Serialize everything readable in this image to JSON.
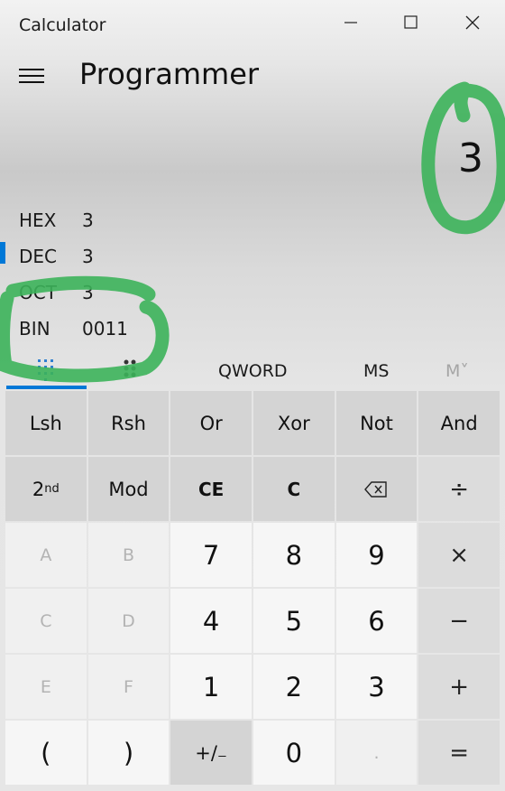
{
  "window": {
    "title": "Calculator"
  },
  "header": {
    "mode": "Programmer"
  },
  "display": {
    "value": "3"
  },
  "radix": [
    {
      "name": "HEX",
      "value": "3"
    },
    {
      "name": "DEC",
      "value": "3",
      "selected": true
    },
    {
      "name": "OCT",
      "value": "3"
    },
    {
      "name": "BIN",
      "value": "0011"
    }
  ],
  "tabs": {
    "word_size": "QWORD",
    "ms": "MS",
    "mplus": "M˅"
  },
  "keys": {
    "lsh": "Lsh",
    "rsh": "Rsh",
    "or": "Or",
    "xor": "Xor",
    "not": "Not",
    "and": "And",
    "second": "2",
    "second_sup": "nd",
    "mod": "Mod",
    "ce": "CE",
    "c": "C",
    "divide": "÷",
    "a": "A",
    "b": "B",
    "seven": "7",
    "eight": "8",
    "nine": "9",
    "multiply": "×",
    "cc": "C",
    "d": "D",
    "four": "4",
    "five": "5",
    "six": "6",
    "minus": "−",
    "e": "E",
    "f": "F",
    "one": "1",
    "two": "2",
    "three": "3",
    "plus": "+",
    "lparen": "(",
    "rparen": ")",
    "negate": "+/₋",
    "zero": "0",
    "decimal": ".",
    "equals": "="
  },
  "colors": {
    "accent": "#0078d7",
    "annotation": "#3cb35a"
  }
}
